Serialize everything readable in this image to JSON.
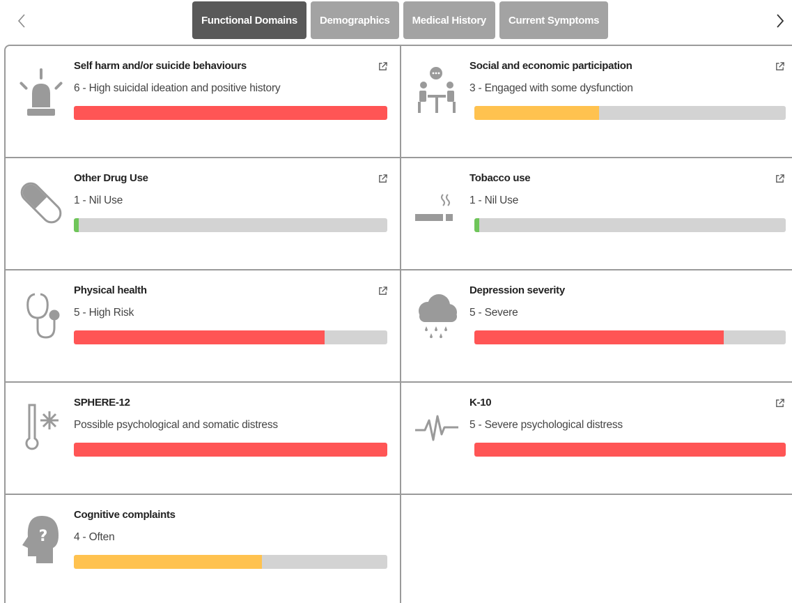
{
  "nav": {
    "prev_icon": "chevron-left-icon",
    "next_icon": "chevron-right-icon"
  },
  "tabs": [
    {
      "label": "Functional Domains",
      "active": true
    },
    {
      "label": "Demographics",
      "active": false
    },
    {
      "label": "Medical History",
      "active": false
    },
    {
      "label": "Current Symptoms",
      "active": false
    }
  ],
  "colors": {
    "red": "#ff5555",
    "orange": "#ffc24f",
    "green": "#6fc55a",
    "track": "#d3d3d3",
    "icon": "#9a9a9a"
  },
  "cards": [
    {
      "title": "Self harm and/or suicide behaviours",
      "desc": "6 - High suicidal ideation and positive history",
      "progress": 1.0,
      "color": "red",
      "icon": "siren-icon",
      "link": true
    },
    {
      "title": "Social and economic participation",
      "desc": "3 - Engaged with some dysfunction",
      "progress": 0.4,
      "color": "orange",
      "icon": "people-meeting-icon",
      "link": true
    },
    {
      "title": "Other Drug Use",
      "desc": "1 - Nil Use",
      "progress": 0.015,
      "color": "green",
      "icon": "pill-capsule-icon",
      "link": true
    },
    {
      "title": "Tobacco use",
      "desc": "1 - Nil Use",
      "progress": 0.015,
      "color": "green",
      "icon": "cigarette-icon",
      "link": true
    },
    {
      "title": "Physical health",
      "desc": "5 - High Risk",
      "progress": 0.8,
      "color": "red",
      "icon": "stethoscope-icon",
      "link": true
    },
    {
      "title": "Depression severity",
      "desc": "5 - Severe",
      "progress": 0.8,
      "color": "red",
      "icon": "rain-cloud-icon",
      "link": false
    },
    {
      "title": "SPHERE-12",
      "desc": "Possible psychological and somatic distress",
      "progress": 1.0,
      "color": "red",
      "icon": "thermometer-cold-icon",
      "link": false
    },
    {
      "title": "K-10",
      "desc": "5 - Severe psychological distress",
      "progress": 1.0,
      "color": "red",
      "icon": "heartbeat-pulse-icon",
      "link": true
    },
    {
      "title": "Cognitive complaints",
      "desc": "4 - Often",
      "progress": 0.6,
      "color": "orange",
      "icon": "head-question-icon",
      "link": false
    }
  ]
}
